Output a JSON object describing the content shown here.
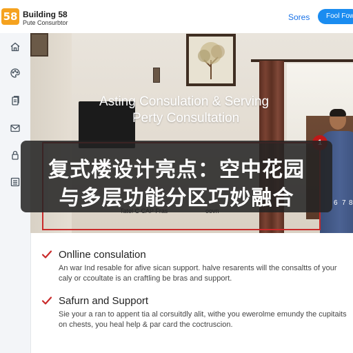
{
  "header": {
    "logo_text": "58",
    "brand_name": "Building 58",
    "brand_sub": "Pute Consurbtor",
    "nav_link": "Sores",
    "nav_button": "Fool Fowi"
  },
  "sidebar": {
    "icons": [
      "home-icon",
      "palette-icon",
      "documents-icon",
      "mail-icon",
      "lock-icon",
      "list-icon"
    ]
  },
  "hero": {
    "title_line1": "Asting Consulation & Serving",
    "title_line2": "Perty Consultation",
    "sub_text_left": "Tatel C CAP Fras",
    "sub_text_right": "oovn",
    "badge": "1",
    "page_ticks": [
      "6",
      "7",
      "8"
    ]
  },
  "overlay": {
    "line1": "复式楼设计亮点：空中花园",
    "line2": "与多层功能分区巧妙融合"
  },
  "features": [
    {
      "title": "Onlline consulation",
      "desc": "An war Ind resable for afive sican support. halve resarents will the consaltts of your caly or ccoultate is an craftling be bras and support."
    },
    {
      "title": "Safurn and Support",
      "desc": "Sie your a ran to appent tia al corsuitdly alit, withe you ewerolme emundy the cupitaits on chests, you heal help & par card the coctruscion."
    }
  ],
  "colors": {
    "accent": "#1a8cf0",
    "logo": "#f5a21f",
    "check": "#c92a2a",
    "highlight_box": "#c92a2a"
  }
}
